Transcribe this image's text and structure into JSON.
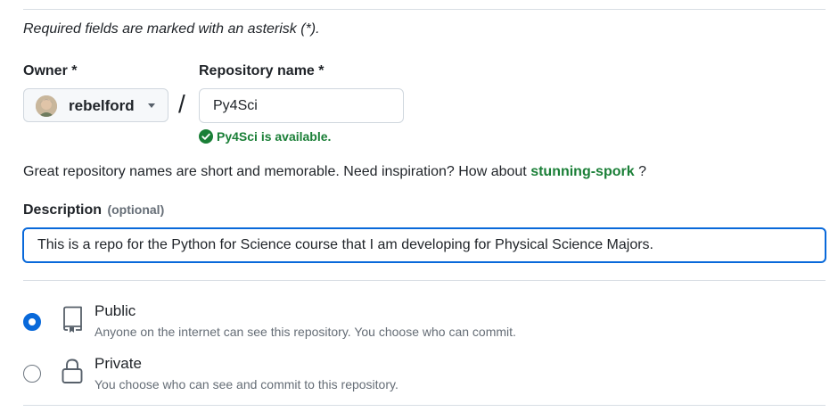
{
  "required_note": "Required fields are marked with an asterisk (*).",
  "owner": {
    "label": "Owner *",
    "name": "rebelford"
  },
  "slash": "/",
  "repository": {
    "label": "Repository name *",
    "value": "Py4Sci",
    "availability": "Py4Sci is available."
  },
  "suggestion": {
    "prefix": "Great repository names are short and memorable. Need inspiration? How about ",
    "name": "stunning-spork",
    "suffix": " ?"
  },
  "description": {
    "label": "Description",
    "optional": "(optional)",
    "value": "This is a repo for the Python for Science course that I am developing for Physical Science Majors."
  },
  "visibility": {
    "selected": "public",
    "options": [
      {
        "id": "public",
        "title": "Public",
        "description": "Anyone on the internet can see this repository. You choose who can commit.",
        "icon": "repo-icon"
      },
      {
        "id": "private",
        "title": "Private",
        "description": "You choose who can see and commit to this repository.",
        "icon": "lock-icon"
      }
    ]
  },
  "colors": {
    "success": "#1a7f37",
    "accent": "#0969da",
    "muted": "#656d76",
    "border": "#d0d7de"
  }
}
